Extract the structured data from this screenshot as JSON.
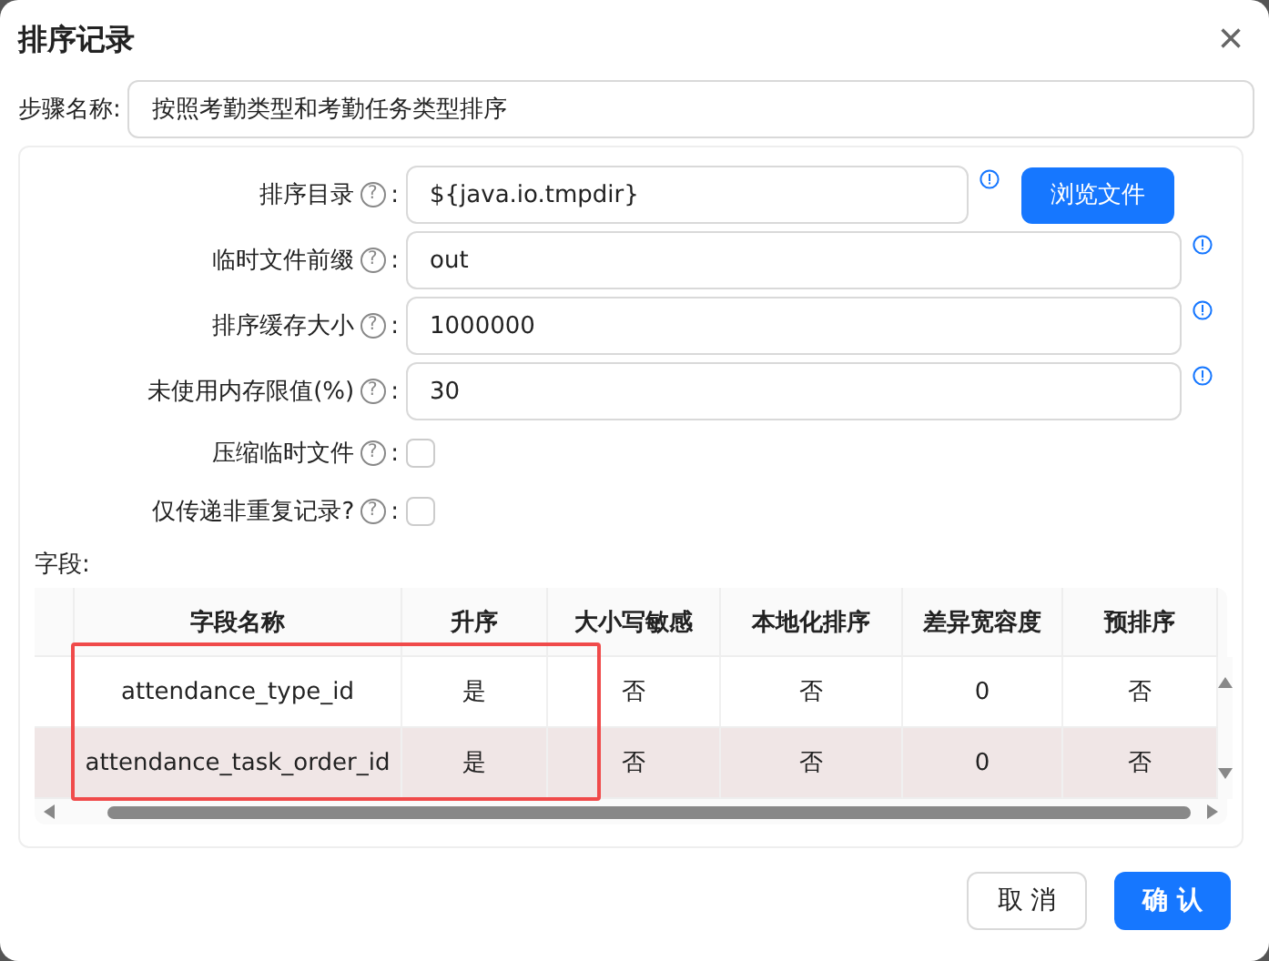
{
  "window": {
    "title": "排序记录",
    "close": "×"
  },
  "step_name": {
    "label": "步骤名称:",
    "value": "按照考勤类型和考勤任务类型排序"
  },
  "fields": [
    {
      "kind": "text",
      "label": "排序目录",
      "help": "?",
      "colon": ":",
      "value": "${java.io.tmpdir}",
      "button": "浏览文件"
    },
    {
      "kind": "text",
      "label": "临时文件前缀",
      "help": "?",
      "colon": ":",
      "value": "out"
    },
    {
      "kind": "text",
      "label": "排序缓存大小",
      "help": "?",
      "colon": ":",
      "value": "1000000"
    },
    {
      "kind": "text",
      "label": "未使用内存限值(%)",
      "help": "?",
      "colon": ":",
      "value": "30"
    },
    {
      "kind": "checkbox",
      "label": "压缩临时文件",
      "help": "?",
      "colon": ":",
      "checked": false
    },
    {
      "kind": "checkbox",
      "label": "仅传递非重复记录?",
      "help": "?",
      "colon": ":",
      "checked": false
    }
  ],
  "table": {
    "label": "字段:",
    "columns": [
      "字段名称",
      "升序",
      "大小写敏感",
      "本地化排序",
      "差异宽容度",
      "预排序"
    ],
    "rows": [
      {
        "cells": [
          "attendance_type_id",
          "是",
          "否",
          "否",
          "0",
          "否"
        ],
        "selected": false
      },
      {
        "cells": [
          "attendance_task_order_id",
          "是",
          "否",
          "否",
          "0",
          "否"
        ],
        "selected": true
      }
    ]
  },
  "buttons": [
    {
      "label": "取 消",
      "kind": "secondary"
    },
    {
      "label": "确 认",
      "kind": "primary"
    }
  ]
}
